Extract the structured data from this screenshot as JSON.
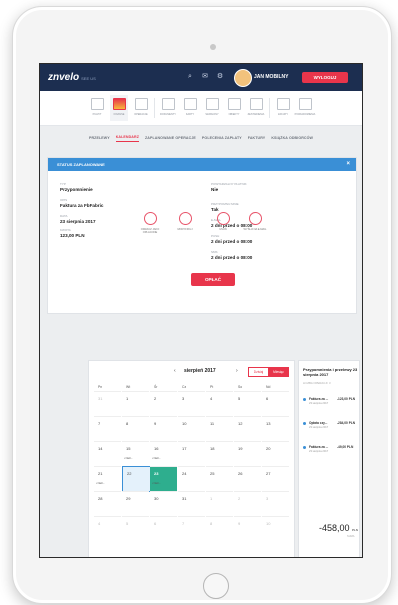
{
  "topbar": {
    "logo": "znvelo",
    "logo_sub": "SEE US",
    "user": "JAN MOBILNY",
    "logout": "WYLOGUJ"
  },
  "modules": [
    {
      "label": "PULPIT",
      "icon": "monitor-icon"
    },
    {
      "label": "FINANSE",
      "icon": "pie-chart-icon",
      "active": true
    },
    {
      "label": "OPERACJE",
      "icon": "list-icon"
    },
    {
      "label": "DOKUMENTY",
      "icon": "document-icon"
    },
    {
      "label": "KARTY",
      "icon": "card-icon"
    },
    {
      "label": "SZABLONY",
      "icon": "bin-icon"
    },
    {
      "label": "OBIEKTY",
      "icon": "globe-icon"
    },
    {
      "label": "ZESTAWIENIA",
      "icon": "pin-icon"
    },
    {
      "label": "ZAKUPY",
      "icon": "cart-icon"
    },
    {
      "label": "POWIADOMIENIA",
      "icon": "file-icon"
    }
  ],
  "subnav": [
    "PRZELEWY",
    "KALENDARZ",
    "ZAPLANOWANE OPERACJE",
    "POLECENIA ZAPŁATY",
    "FAKTURY",
    "KSIĄŻKA ODBIORCÓW"
  ],
  "card": {
    "title": "STATUS ZAPLANOWANE",
    "fields_left": [
      {
        "k": "TYP",
        "v": "Przypomnienie"
      },
      {
        "k": "OPIS",
        "v": "Faktura za FbFabric"
      },
      {
        "k": "DATA",
        "v": "23 sierpnia 2017"
      },
      {
        "k": "KWOTA",
        "v": "123,00 PLN"
      }
    ],
    "fields_right": [
      {
        "k": "POWTARZALNY PŁATNIK",
        "v": "Nie"
      },
      {
        "k": "PRZYPOMNIJ MNIE",
        "v": "Tak"
      },
      {
        "k": "E-MAIL",
        "v": "2 dni przed o 08:00"
      },
      {
        "k": "PUSH",
        "v": "2 dni przed o 08:00"
      },
      {
        "k": "SMS",
        "v": "2 dni przed o 08:00"
      }
    ],
    "pay": "OPŁAĆ"
  },
  "actions": [
    {
      "label": "ODRACZ JAKO OPŁACONE",
      "icon": "check-icon"
    },
    {
      "label": "MODYFIKUJ",
      "icon": "edit-icon"
    },
    {
      "label": "USUŃ",
      "icon": "trash-icon"
    },
    {
      "label": "WYŚLIJ NA E-MAIL",
      "icon": "mail-icon"
    }
  ],
  "calendar": {
    "prev": "‹",
    "next": "›",
    "month": "sierpień 2017",
    "today_btn": "Dzisiaj",
    "week_btn": "Miesiąc",
    "weekdays": [
      "Pn",
      "Wt",
      "Śr",
      "Cz",
      "Pt",
      "So",
      "Nd"
    ],
    "rows": [
      [
        "31",
        "1",
        "2",
        "3",
        "4",
        "5",
        "6"
      ],
      [
        "7",
        "8",
        "9",
        "10",
        "11",
        "12",
        "13"
      ],
      [
        "14",
        "15",
        "16",
        "17",
        "18",
        "19",
        "20"
      ],
      [
        "21",
        "22",
        "23",
        "24",
        "25",
        "26",
        "27"
      ],
      [
        "28",
        "29",
        "30",
        "31",
        "1",
        "2",
        "3"
      ],
      [
        "4",
        "5",
        "6",
        "7",
        "8",
        "9",
        "10"
      ]
    ],
    "events": [
      {
        "r": 2,
        "c": 1,
        "text": "• Nazi..."
      },
      {
        "r": 2,
        "c": 2,
        "text": "• Nazi..."
      },
      {
        "r": 3,
        "c": 0,
        "text": "• Nazi..."
      },
      {
        "r": 3,
        "c": 2,
        "text": "• Nazi..."
      }
    ]
  },
  "side": {
    "title": "Przypomnienia i przelewy 23 sierpnia 2017",
    "subtitle": "LICZBA OPERACJI: 3",
    "items": [
      {
        "name": "Faktura za ...",
        "amount": "-123,00 PLN",
        "date": "23 sierpnia 2017"
      },
      {
        "name": "Opłata czy...",
        "amount": "-284,00 PLN",
        "date": "23 sierpnia 2017"
      },
      {
        "name": "Faktura za ...",
        "amount": "-49,00 PLN",
        "date": "23 sierpnia 2017"
      }
    ],
    "total": "-458,00",
    "currency": "PLN",
    "total_label": "SUMA"
  }
}
